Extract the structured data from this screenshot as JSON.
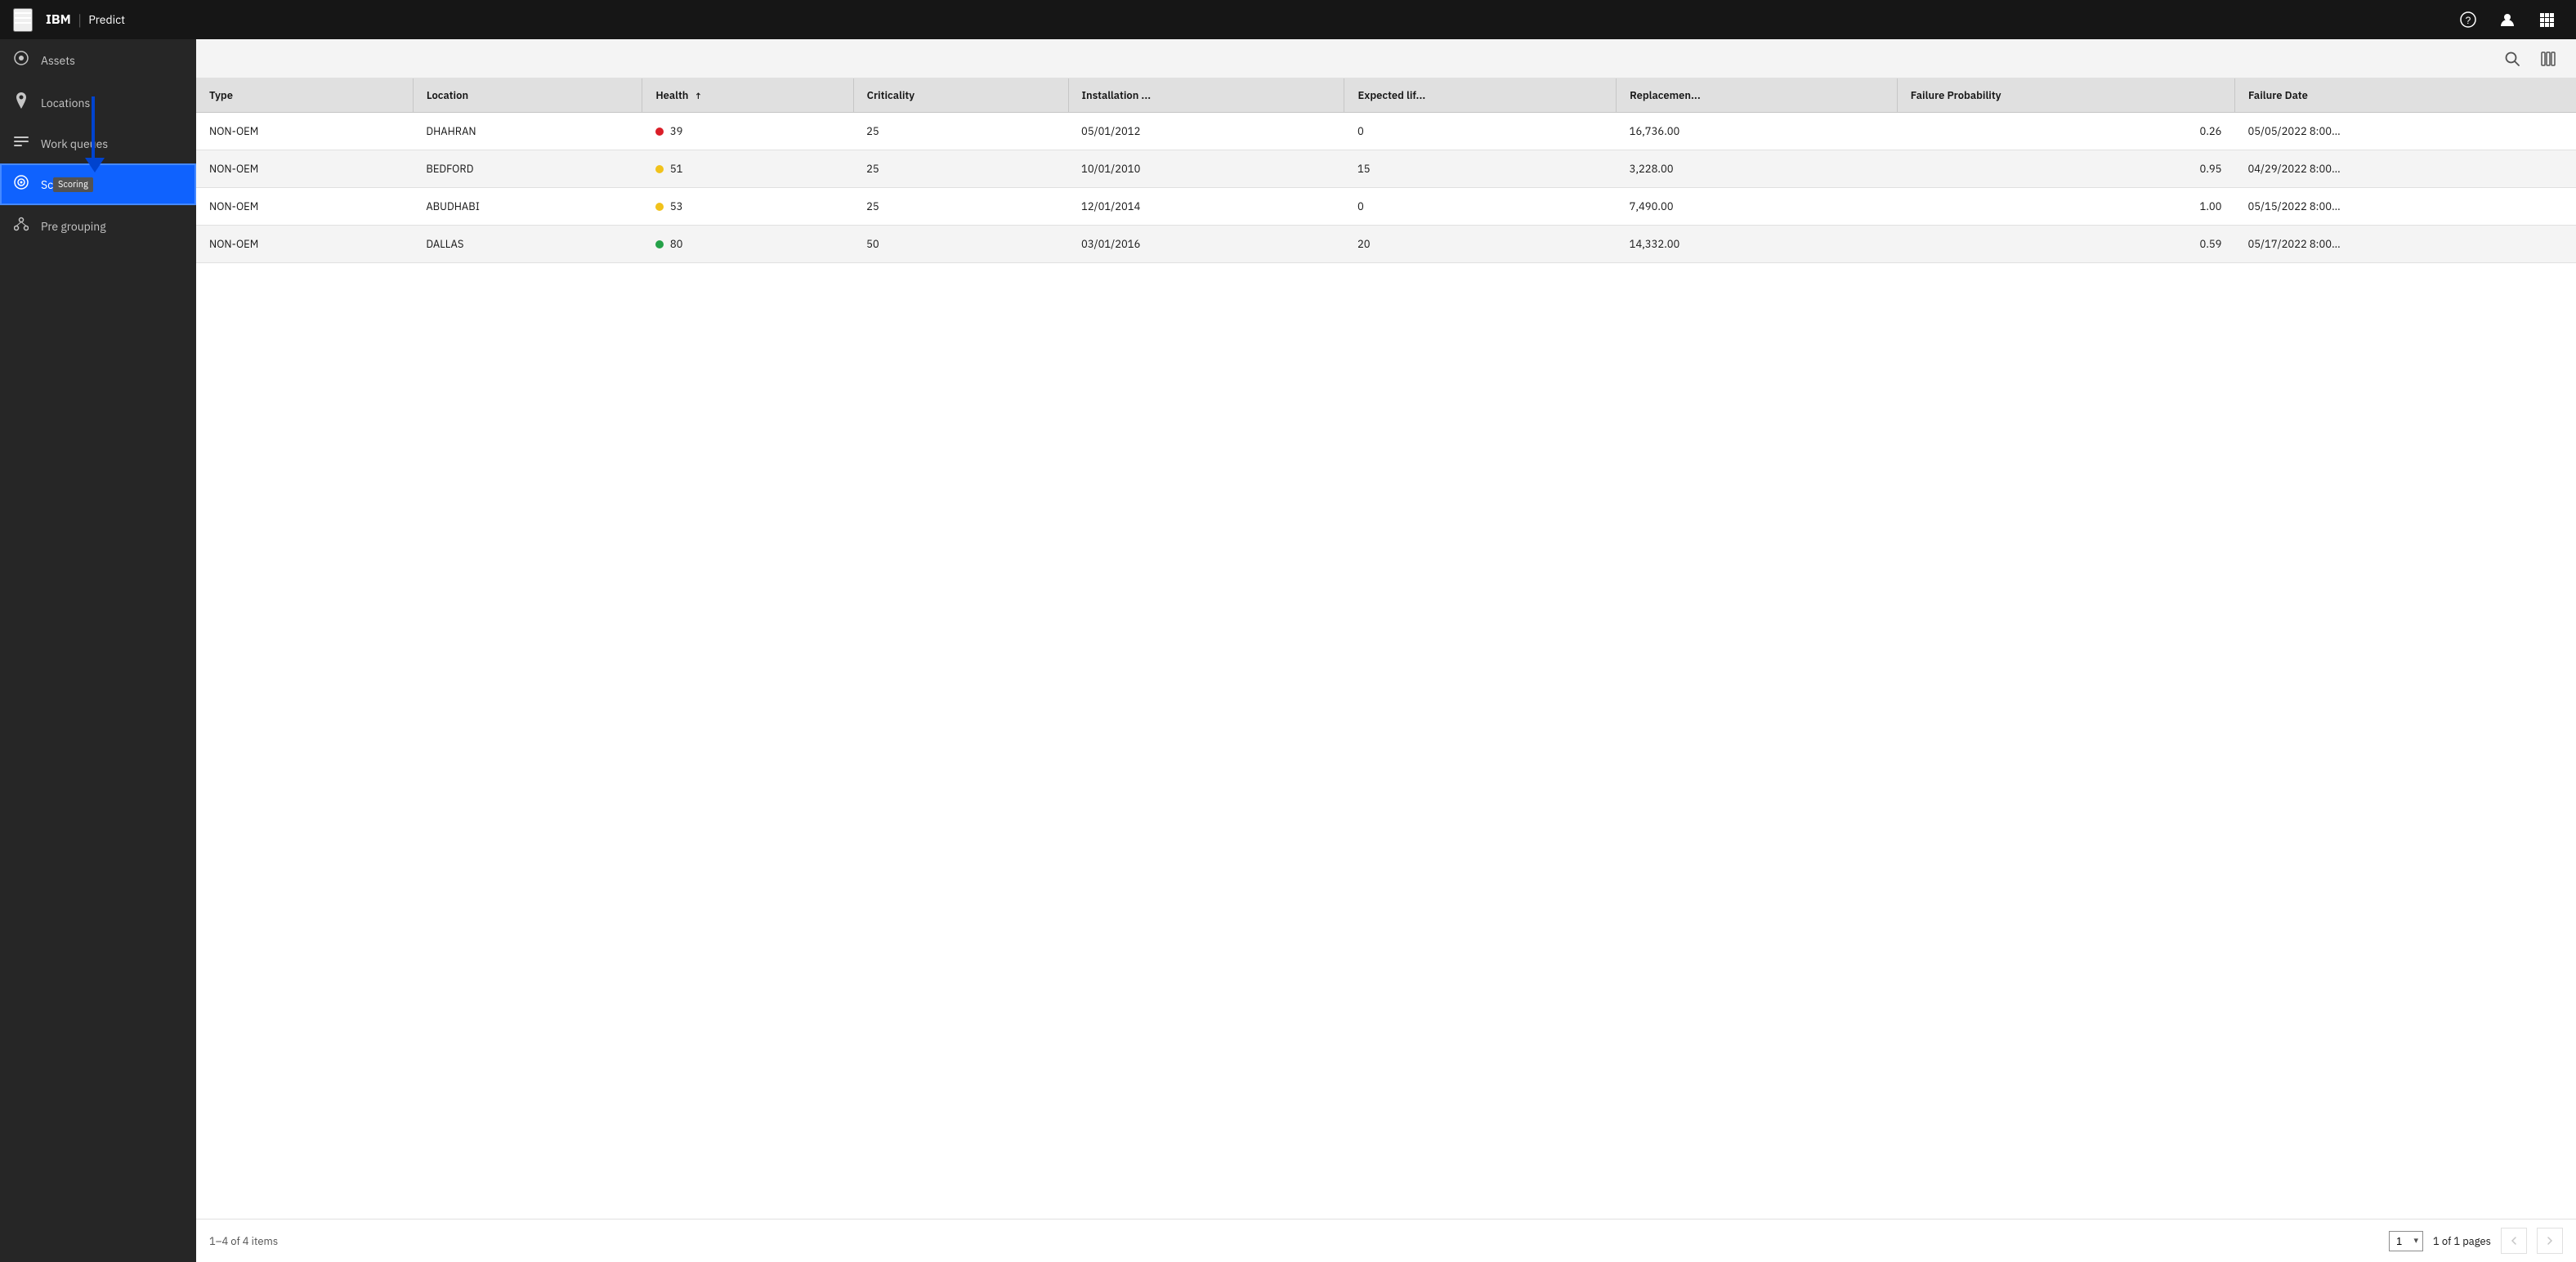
{
  "topbar": {
    "menu_label": "☰",
    "brand_ibm": "IBM",
    "brand_divider": "|",
    "brand_app": "Predict",
    "icon_help": "?",
    "icon_user": "👤",
    "icon_apps": "⋮⋮⋮"
  },
  "sidebar": {
    "items": [
      {
        "id": "assets",
        "label": "Assets",
        "icon": "◯"
      },
      {
        "id": "locations",
        "label": "Locations",
        "icon": "📍"
      },
      {
        "id": "work-queues",
        "label": "Work queues",
        "icon": "≡"
      },
      {
        "id": "scoring",
        "label": "Scoring",
        "icon": "◎",
        "active": true,
        "tooltip": "Scoring"
      },
      {
        "id": "pre-grouping",
        "label": "Pre grouping",
        "icon": "⊕"
      }
    ]
  },
  "toolbar": {
    "search_icon": "🔍",
    "columns_icon": "⊞"
  },
  "table": {
    "columns": [
      {
        "id": "type",
        "label": "Type",
        "sortable": false
      },
      {
        "id": "location",
        "label": "Location",
        "sortable": false
      },
      {
        "id": "health",
        "label": "Health",
        "sortable": true,
        "sorted": "asc"
      },
      {
        "id": "criticality",
        "label": "Criticality",
        "sortable": false
      },
      {
        "id": "installation",
        "label": "Installation ...",
        "sortable": false
      },
      {
        "id": "expected_life",
        "label": "Expected lif...",
        "sortable": false
      },
      {
        "id": "replacement",
        "label": "Replacemen...",
        "sortable": false
      },
      {
        "id": "failure_prob",
        "label": "Failure Probability",
        "sortable": false
      },
      {
        "id": "failure_date",
        "label": "Failure Date",
        "sortable": false
      }
    ],
    "rows": [
      {
        "type": "NON-OEM",
        "location": "DHAHRAN",
        "health": 39,
        "health_status": "red",
        "criticality": 25,
        "installation": "05/01/2012",
        "expected_life": 0,
        "replacement": "16,736.00",
        "failure_prob": "0.26",
        "failure_date": "05/05/2022 8:00..."
      },
      {
        "type": "NON-OEM",
        "location": "BEDFORD",
        "health": 51,
        "health_status": "yellow",
        "criticality": 25,
        "installation": "10/01/2010",
        "expected_life": 15,
        "replacement": "3,228.00",
        "failure_prob": "0.95",
        "failure_date": "04/29/2022 8:00..."
      },
      {
        "type": "NON-OEM",
        "location": "ABUDHABI",
        "health": 53,
        "health_status": "yellow",
        "criticality": 25,
        "installation": "12/01/2014",
        "expected_life": 0,
        "replacement": "7,490.00",
        "failure_prob": "1.00",
        "failure_date": "05/15/2022 8:00..."
      },
      {
        "type": "NON-OEM",
        "location": "DALLAS",
        "health": 80,
        "health_status": "green",
        "criticality": 50,
        "installation": "03/01/2016",
        "expected_life": 20,
        "replacement": "14,332.00",
        "failure_prob": "0.59",
        "failure_date": "05/17/2022 8:00..."
      }
    ]
  },
  "pagination": {
    "items_label": "1–4 of 4 items",
    "page_select": "1",
    "pages_label": "1 of 1 pages",
    "prev_disabled": true,
    "next_disabled": true
  }
}
